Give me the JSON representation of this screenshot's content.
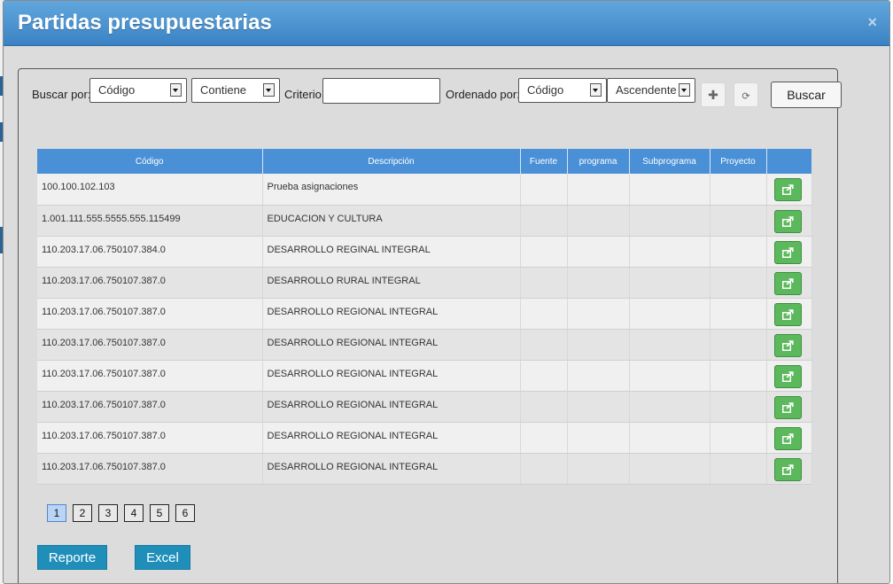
{
  "modal": {
    "title": "Partidas presupuestarias",
    "close": "×"
  },
  "search": {
    "buscar_por_label": "Buscar por:",
    "field_selected": "Código",
    "operator_selected": "Contiene",
    "criterio_label": "Criterio:",
    "criterio_value": "",
    "ordenado_label": "Ordenado por:",
    "order_field_selected": "Código",
    "order_dir_selected": "Ascendente",
    "add_icon": "plus-icon",
    "reset_icon": "refresh-icon",
    "buscar_button": "Buscar"
  },
  "table": {
    "headers": [
      "Código",
      "Descripción",
      "Fuente",
      "programa",
      "Subprograma",
      "Proyecto",
      ""
    ],
    "rows": [
      {
        "codigo": "100.100.102.103",
        "descripcion": "Prueba asignaciones"
      },
      {
        "codigo": "1.001.111.555.5555.555.115499",
        "descripcion": "EDUCACION Y CULTURA"
      },
      {
        "codigo": "110.203.17.06.750107.384.0",
        "descripcion": "DESARROLLO REGINAL INTEGRAL"
      },
      {
        "codigo": "110.203.17.06.750107.387.0",
        "descripcion": "DESARROLLO RURAL INTEGRAL"
      },
      {
        "codigo": "110.203.17.06.750107.387.0",
        "descripcion": "DESARROLLO REGIONAL INTEGRAL"
      },
      {
        "codigo": "110.203.17.06.750107.387.0",
        "descripcion": "DESARROLLO REGIONAL INTEGRAL"
      },
      {
        "codigo": "110.203.17.06.750107.387.0",
        "descripcion": "DESARROLLO REGIONAL INTEGRAL"
      },
      {
        "codigo": "110.203.17.06.750107.387.0",
        "descripcion": "DESARROLLO REGIONAL INTEGRAL"
      },
      {
        "codigo": "110.203.17.06.750107.387.0",
        "descripcion": "DESARROLLO REGIONAL INTEGRAL"
      },
      {
        "codigo": "110.203.17.06.750107.387.0",
        "descripcion": "DESARROLLO REGIONAL INTEGRAL"
      }
    ],
    "row_action_icon": "share-icon"
  },
  "pagination": {
    "pages": [
      "1",
      "2",
      "3",
      "4",
      "5",
      "6"
    ],
    "current": "1"
  },
  "footer": {
    "reporte_button": "Reporte",
    "excel_button": "Excel"
  },
  "colors": {
    "header_blue": "#3b82c4",
    "table_header": "#4a90d6",
    "action_green": "#5cb85c",
    "footer_button": "#1f8fba"
  }
}
